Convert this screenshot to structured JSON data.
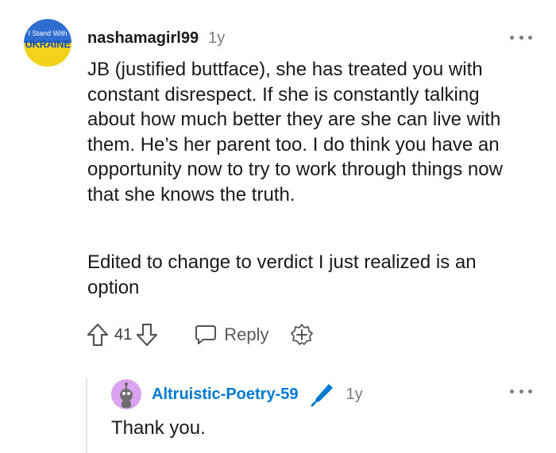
{
  "comment": {
    "avatar_line1": "I Stand With",
    "avatar_line2": "UKRAINE",
    "username": "nashamagirl99",
    "age": "1y",
    "paragraph1": "JB (justified buttface), she has treated you with constant disrespect. If she is constantly talking about how much better they are she can live with them. He’s her parent too. I do think you have an opportunity now to try to work through things now that she knows the truth.",
    "paragraph2": "Edited to change to verdict I just realized is an option",
    "vote_count": "41",
    "reply_label": "Reply"
  },
  "reply": {
    "username": "Altruistic-Poetry-59",
    "age": "1y",
    "text": "Thank you."
  },
  "colors": {
    "username_link": "#0079d3",
    "meta_gray": "#7c7c7c",
    "thread_line": "#e4e6e8",
    "reply_avatar_bg": "#d9a3ef"
  },
  "icons": [
    "more-options-icon",
    "upvote-arrow-icon",
    "downvote-arrow-icon",
    "reply-bubble-icon",
    "award-plus-icon",
    "pencil-icon"
  ]
}
